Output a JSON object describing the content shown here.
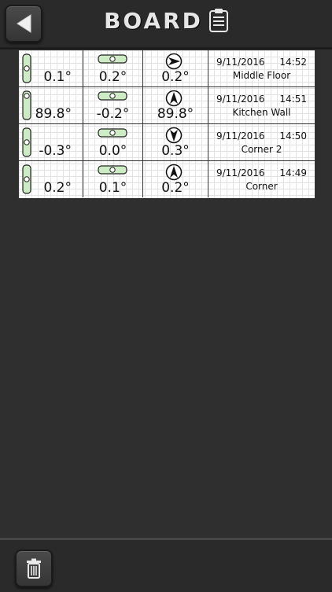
{
  "header": {
    "title": "BOARD",
    "back_icon": "back-arrow-icon",
    "clipboard_icon": "clipboard-icon"
  },
  "readings": [
    {
      "vertical": "0.1°",
      "horizontal": "0.2°",
      "direction": "0.2°",
      "direction_arrow": "right",
      "date": "9/11/2016",
      "time": "14:52",
      "name": "Middle Floor"
    },
    {
      "vertical": "89.8°",
      "horizontal": "-0.2°",
      "direction": "89.8°",
      "direction_arrow": "up",
      "date": "9/11/2016",
      "time": "14:51",
      "name": "Kitchen Wall"
    },
    {
      "vertical": "-0.3°",
      "horizontal": "0.0°",
      "direction": "0.3°",
      "direction_arrow": "down",
      "date": "9/11/2016",
      "time": "14:50",
      "name": "Corner 2"
    },
    {
      "vertical": "0.2°",
      "horizontal": "0.1°",
      "direction": "0.2°",
      "direction_arrow": "up",
      "date": "9/11/2016",
      "time": "14:49",
      "name": "Corner"
    }
  ],
  "footer": {
    "trash_icon": "trash-icon"
  },
  "colors": {
    "background": "#2f2f2f",
    "bubble_fill": "#cdebc4",
    "board": "#ffffff"
  }
}
